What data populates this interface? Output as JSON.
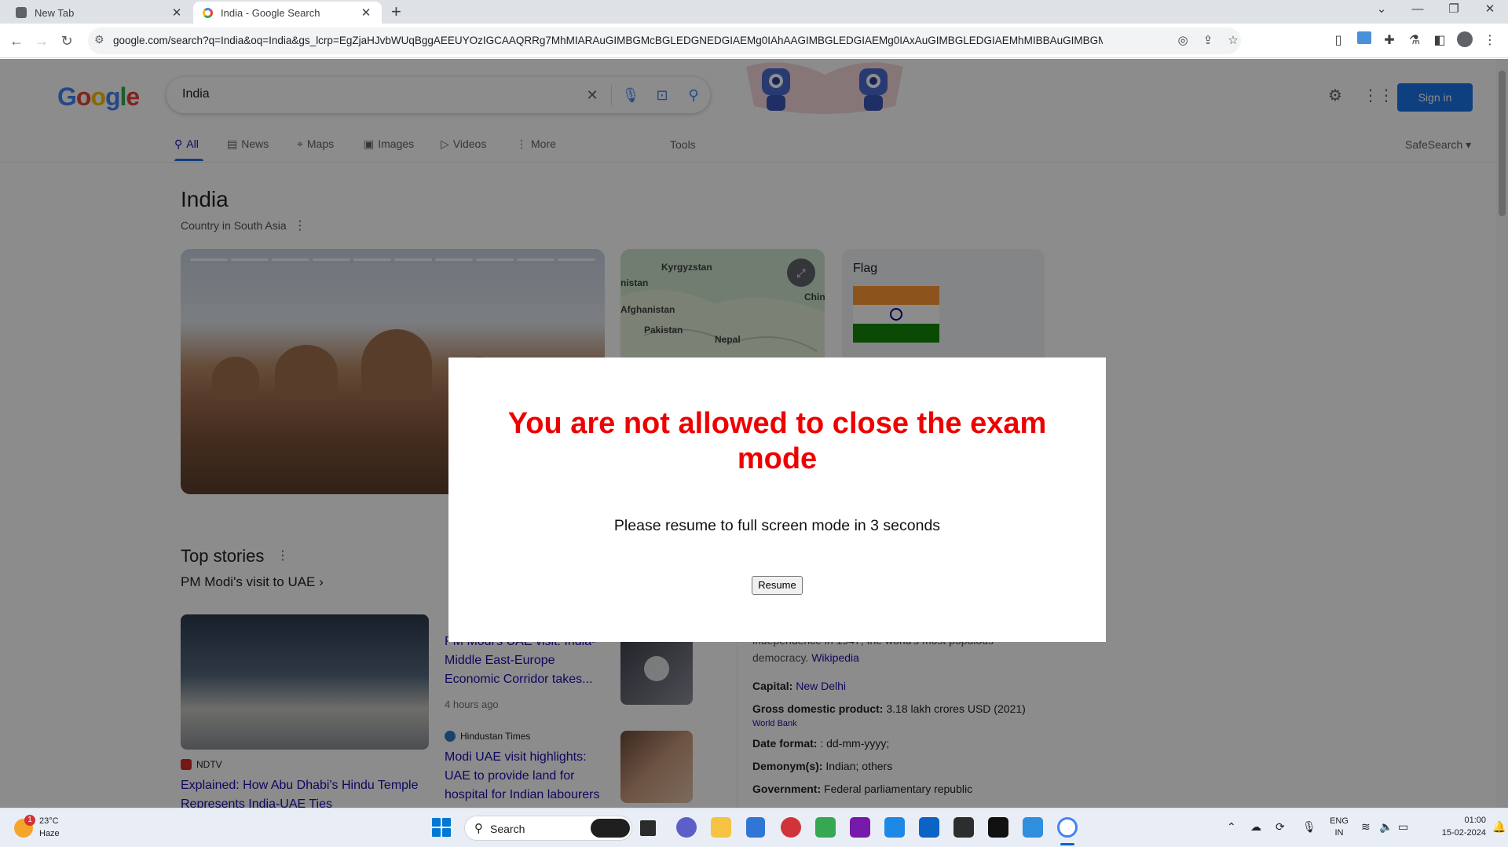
{
  "browser": {
    "tabs": [
      {
        "title": "New Tab",
        "active": false
      },
      {
        "title": "India - Google Search",
        "active": true
      }
    ],
    "url": "google.com/search?q=India&oq=India&gs_lcrp=EgZjaHJvbWUqBggAEEUYOzIGCAAQRRg7MhMIARAuGIMBGMcBGLEDGNEDGIAEMg0IAhAAGIMBGLEDGIAEMg0IAxAuGIMBGLEDGIAEMhMIBBAuGIMBGMcBGLEDGNEDGIAEMg0IBR..."
  },
  "google": {
    "logo": [
      "G",
      "o",
      "o",
      "g",
      "l",
      "e"
    ],
    "query": "India",
    "nav_tabs": [
      {
        "label": "All",
        "icon": "search-icon"
      },
      {
        "label": "News",
        "icon": "news-icon"
      },
      {
        "label": "Maps",
        "icon": "map-pin-icon"
      },
      {
        "label": "Images",
        "icon": "image-icon"
      },
      {
        "label": "Videos",
        "icon": "video-icon"
      },
      {
        "label": "More",
        "icon": "more-vert-icon"
      }
    ],
    "tools": "Tools",
    "safesearch": "SafeSearch",
    "sign_in": "Sign in"
  },
  "knowledge_panel": {
    "title": "India",
    "subtitle": "Country in South Asia",
    "map_labels": [
      "Kyrgyzstan",
      "nistan",
      "China",
      "Afghanistan",
      "Pakistan",
      "Nepal"
    ],
    "flag_label": "Flag",
    "flag_colors": [
      "#ff9933",
      "#ffffff",
      "#138808"
    ],
    "description_line1": "independence in 1947, the world's most populous",
    "description_line2": "democracy.",
    "wikipedia": "Wikipedia",
    "facts": [
      {
        "key": "Capital:",
        "value": "",
        "link": "New Delhi"
      },
      {
        "key": "Gross domestic product:",
        "value": "3.18 lakh crores USD (2021)",
        "link": ""
      },
      {
        "key": "Date format:",
        "value": ": dd-mm-yyyy;",
        "link": ""
      },
      {
        "key": "Demonym(s):",
        "value": "Indian; others",
        "link": ""
      },
      {
        "key": "Government:",
        "value": "Federal parliamentary republic",
        "link": ""
      }
    ],
    "gdp_source": "World Bank"
  },
  "top_stories": {
    "title": "Top stories",
    "subtitle": "PM Modi's visit to UAE",
    "stories": [
      {
        "source": "NDTV",
        "title": "Explained: How Abu Dhabi's Hindu Temple Represents India-UAE Ties",
        "time": ""
      },
      {
        "source": "",
        "title": "PM Modi's UAE visit: India-Middle East-Europe Economic Corridor takes...",
        "time": "4 hours ago"
      },
      {
        "source": "Hindustan Times",
        "title": "Modi UAE visit highlights: UAE to provide land for hospital for Indian labourers",
        "time": ""
      }
    ]
  },
  "modal": {
    "title": "You are not allowed to close the exam mode",
    "message": "Please resume to full screen mode in 3 seconds",
    "button": "Resume"
  },
  "taskbar": {
    "weather_temp": "23°C",
    "weather_cond": "Haze",
    "weather_badge": "1",
    "search_label": "Search",
    "lang_line1": "ENG",
    "lang_line2": "IN",
    "time": "01:00",
    "date": "15-02-2024"
  }
}
